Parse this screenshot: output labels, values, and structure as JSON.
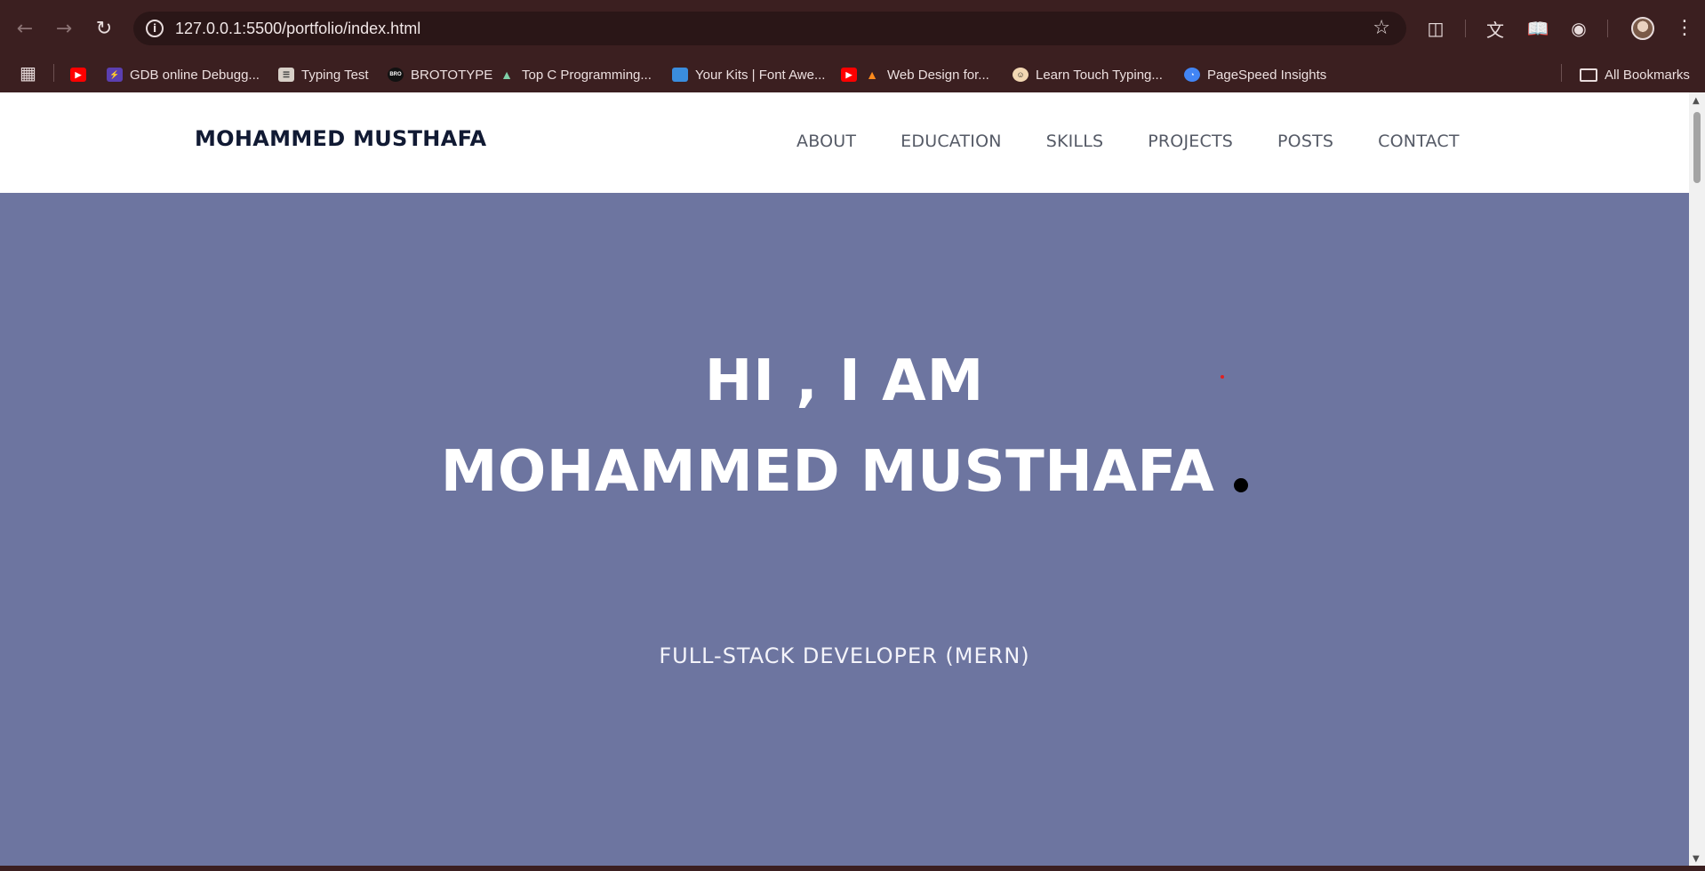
{
  "browser": {
    "url": "127.0.0.1:5500/portfolio/index.html",
    "icons": [
      "back-arrow-icon",
      "forward-arrow-icon",
      "reload-icon",
      "info-icon",
      "star-icon",
      "extensions-icon",
      "translate-icon",
      "reading-mode-icon",
      "incognito-icon",
      "menu-icon"
    ]
  },
  "bookmarks": {
    "items": [
      {
        "label": "",
        "icon": "youtube"
      },
      {
        "label": "GDB online Debugg...",
        "icon": "gdb"
      },
      {
        "label": "Typing Test",
        "icon": "doc"
      },
      {
        "label": "BROTOTYPE",
        "icon": "bro"
      },
      {
        "label": "Top C Programming...",
        "icon": "mountain"
      },
      {
        "label": "Your Kits | Font Awe...",
        "icon": "flag"
      },
      {
        "label": "Web Design for...",
        "icon": "youtube-fire"
      },
      {
        "label": "Learn Touch Typing...",
        "icon": "face"
      },
      {
        "label": "PageSpeed Insights",
        "icon": "pagespeed"
      }
    ],
    "all_bookmarks": "All Bookmarks"
  },
  "site": {
    "brand": "MOHAMMED MUSTHAFA",
    "nav": [
      "ABOUT",
      "EDUCATION",
      "SKILLS",
      "PROJECTS",
      "POSTS",
      "CONTACT"
    ],
    "hero": {
      "line1": "HI , I AM",
      "line2": "MOHAMMED MUSTHAFA",
      "subtitle": "FULL-STACK DEVELOPER (MERN)"
    },
    "colors": {
      "hero_bg": "#6d75a0",
      "brand_text": "#111a33",
      "nav_text": "#555a66",
      "chrome_bg": "#3b1f20"
    }
  }
}
